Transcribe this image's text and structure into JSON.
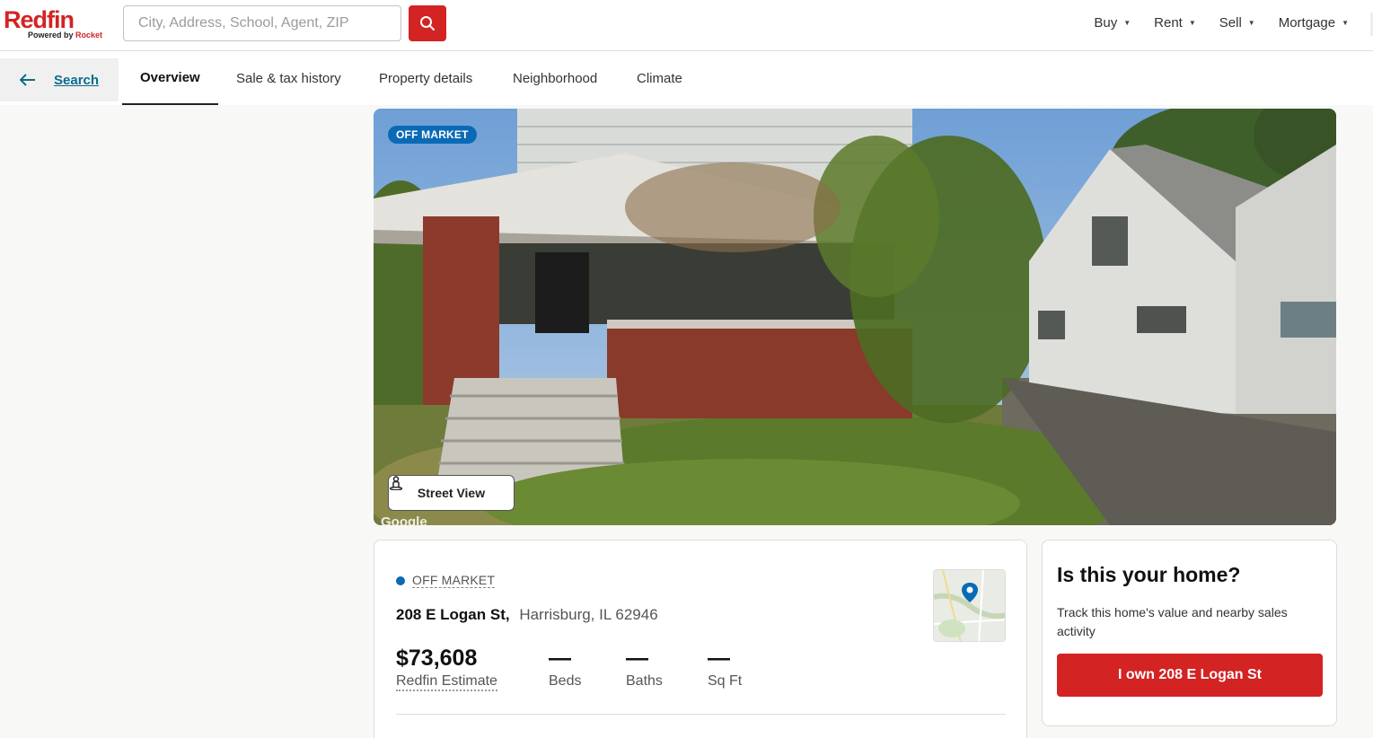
{
  "brand": {
    "logo_text": "Redfin",
    "powered_by": "Powered by",
    "powered_by_brand": "Rocket",
    "accent_color": "#d32323"
  },
  "search": {
    "placeholder": "City, Address, School, Agent, ZIP",
    "value": ""
  },
  "nav": {
    "items": [
      {
        "label": "Buy"
      },
      {
        "label": "Rent"
      },
      {
        "label": "Sell"
      },
      {
        "label": "Mortgage"
      }
    ]
  },
  "subnav": {
    "back_label": "Search",
    "tabs": [
      {
        "label": "Overview",
        "active": true
      },
      {
        "label": "Sale & tax history"
      },
      {
        "label": "Property details"
      },
      {
        "label": "Neighborhood"
      },
      {
        "label": "Climate"
      }
    ]
  },
  "photo": {
    "badge": "OFF MARKET",
    "street_view_label": "Street View",
    "watermark": "Google"
  },
  "listing": {
    "status": "OFF MARKET",
    "street": "208 E Logan St,",
    "city_state_zip": "Harrisburg, IL 62946",
    "estimate_value": "$73,608",
    "estimate_label": "Redfin Estimate",
    "beds_value": "—",
    "beds_label": "Beds",
    "baths_value": "—",
    "baths_label": "Baths",
    "sqft_value": "—",
    "sqft_label": "Sq Ft",
    "status_color": "#0a6ab5"
  },
  "owner_card": {
    "title": "Is this your home?",
    "description": "Track this home's value and nearby sales activity",
    "button_label": "I own 208 E Logan St"
  }
}
